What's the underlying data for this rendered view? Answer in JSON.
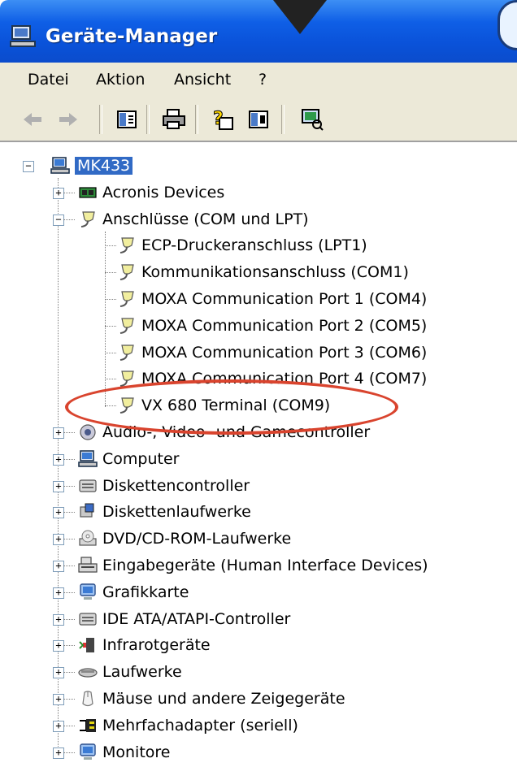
{
  "window": {
    "title": "Geräte-Manager"
  },
  "menu": [
    {
      "label": "Datei"
    },
    {
      "label": "Aktion"
    },
    {
      "label": "Ansicht"
    },
    {
      "label": "?"
    }
  ],
  "toolbar": {
    "buttons": [
      "back-icon",
      "forward-icon",
      "properties-icon",
      "print-icon",
      "help-icon",
      "view-icon",
      "scan-hardware-icon"
    ]
  },
  "tree": {
    "root": {
      "label": "MK433",
      "expanded": true,
      "selected": true
    },
    "children": [
      {
        "label": "Acronis Devices",
        "expanded": false,
        "icon": "chip-icon"
      },
      {
        "label": "Anschlüsse (COM und LPT)",
        "expanded": true,
        "icon": "port-icon",
        "children": [
          {
            "label": "ECP-Druckeranschluss (LPT1)"
          },
          {
            "label": "Kommunikationsanschluss (COM1)"
          },
          {
            "label": "MOXA Communication Port 1 (COM4)"
          },
          {
            "label": "MOXA Communication Port 2 (COM5)"
          },
          {
            "label": "MOXA Communication Port 3 (COM6)"
          },
          {
            "label": "MOXA Communication Port 4 (COM7)"
          },
          {
            "label": "VX 680 Terminal (COM9)",
            "highlighted": true
          }
        ]
      },
      {
        "label": "Audio-, Video- und Gamecontroller",
        "expanded": false,
        "icon": "audio-icon"
      },
      {
        "label": "Computer",
        "expanded": false,
        "icon": "computer-icon"
      },
      {
        "label": "Diskettencontroller",
        "expanded": false,
        "icon": "controller-icon"
      },
      {
        "label": "Diskettenlaufwerke",
        "expanded": false,
        "icon": "floppy-icon"
      },
      {
        "label": "DVD/CD-ROM-Laufwerke",
        "expanded": false,
        "icon": "cd-icon"
      },
      {
        "label": "Eingabegeräte (Human Interface Devices)",
        "expanded": false,
        "icon": "hid-icon"
      },
      {
        "label": "Grafikkarte",
        "expanded": false,
        "icon": "monitor-icon"
      },
      {
        "label": "IDE ATA/ATAPI-Controller",
        "expanded": false,
        "icon": "controller-icon"
      },
      {
        "label": "Infrarotgeräte",
        "expanded": false,
        "icon": "infrared-icon"
      },
      {
        "label": "Laufwerke",
        "expanded": false,
        "icon": "drive-icon"
      },
      {
        "label": "Mäuse und andere Zeigegeräte",
        "expanded": false,
        "icon": "mouse-icon"
      },
      {
        "label": "Mehrfachadapter (seriell)",
        "expanded": false,
        "icon": "multiport-icon"
      },
      {
        "label": "Monitore",
        "expanded": false,
        "icon": "monitor-icon"
      }
    ]
  },
  "colors": {
    "titlebar": "#0a52d9",
    "selection": "#316ac5",
    "highlight_ring": "#d9442e"
  }
}
